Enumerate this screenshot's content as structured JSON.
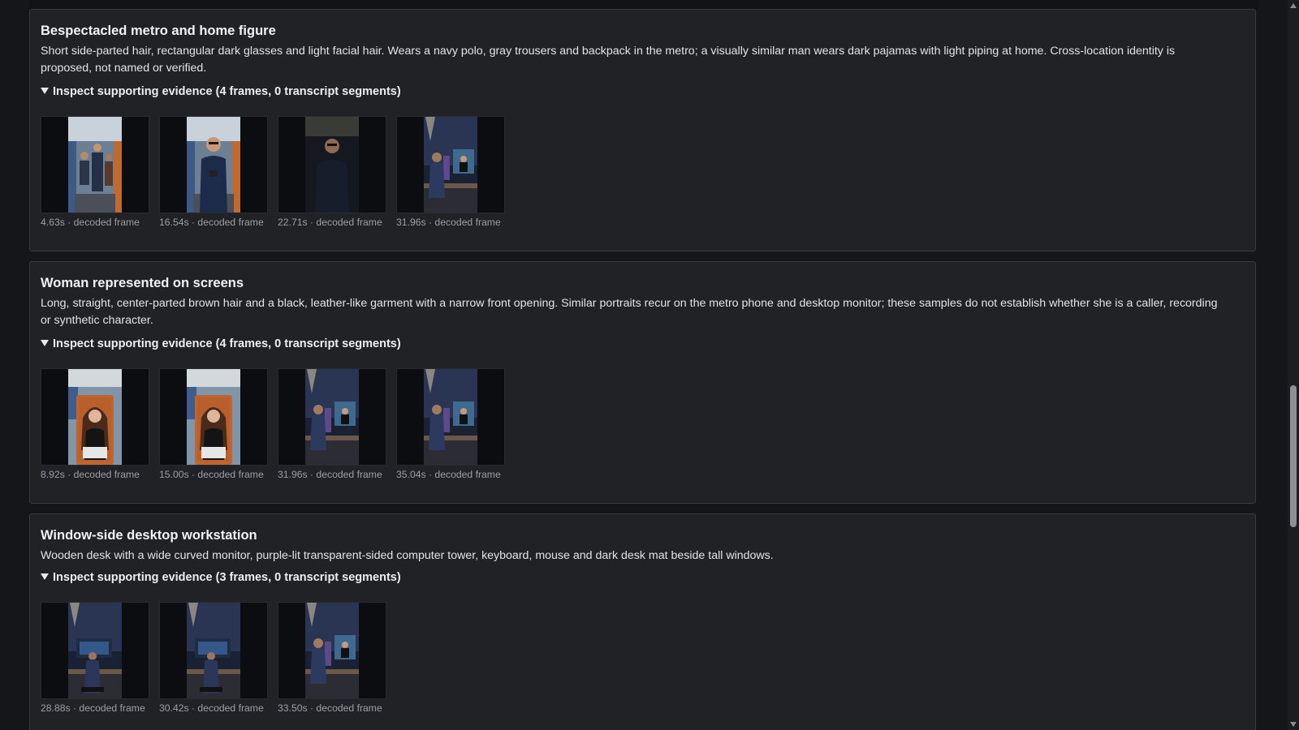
{
  "cards": [
    {
      "title": "Bespectacled metro and home figure",
      "description": "Short side-parted hair, rectangular dark glasses and light facial hair. Wears a navy polo, gray trousers and backpack in the metro; a visually similar man wears dark pajamas with light piping at home. Cross-location identity is proposed, not named or verified.",
      "evidence_label": "Inspect supporting evidence (4 frames, 0 transcript segments)",
      "frames": [
        {
          "caption": "4.63s · decoded frame",
          "scene": "metro-crowd"
        },
        {
          "caption": "16.54s · decoded frame",
          "scene": "metro-man-phone"
        },
        {
          "caption": "22.71s · decoded frame",
          "scene": "dark-man"
        },
        {
          "caption": "31.96s · decoded frame",
          "scene": "desk-monitor"
        }
      ]
    },
    {
      "title": "Woman represented on screens",
      "description": "Long, straight, center-parted brown hair and a black, leather-like garment with a narrow front opening. Similar portraits recur on the metro phone and desktop monitor; these samples do not establish whether she is a caller, recording or synthetic character.",
      "evidence_label": "Inspect supporting evidence (4 frames, 0 transcript segments)",
      "frames": [
        {
          "caption": "8.92s · decoded frame",
          "scene": "phone-woman"
        },
        {
          "caption": "15.00s · decoded frame",
          "scene": "phone-woman"
        },
        {
          "caption": "31.96s · decoded frame",
          "scene": "desk-monitor"
        },
        {
          "caption": "35.04s · decoded frame",
          "scene": "desk-monitor"
        }
      ]
    },
    {
      "title": "Window-side desktop workstation",
      "description": "Wooden desk with a wide curved monitor, purple-lit transparent-sided computer tower, keyboard, mouse and dark desk mat beside tall windows.",
      "evidence_label": "Inspect supporting evidence (3 frames, 0 transcript segments)",
      "frames": [
        {
          "caption": "28.88s · decoded frame",
          "scene": "desk-window"
        },
        {
          "caption": "30.42s · decoded frame",
          "scene": "desk-window"
        },
        {
          "caption": "33.50s · decoded frame",
          "scene": "desk-monitor"
        }
      ]
    }
  ],
  "colors": {
    "page_bg": "#151619",
    "card_bg": "#212226",
    "card_border": "#3a3c42",
    "caption": "#9c9ea5"
  },
  "icons": {
    "disclosure": "triangle-down-icon"
  },
  "scrollbar": {
    "position_fraction": 0.66,
    "visible_fraction": 0.2
  }
}
